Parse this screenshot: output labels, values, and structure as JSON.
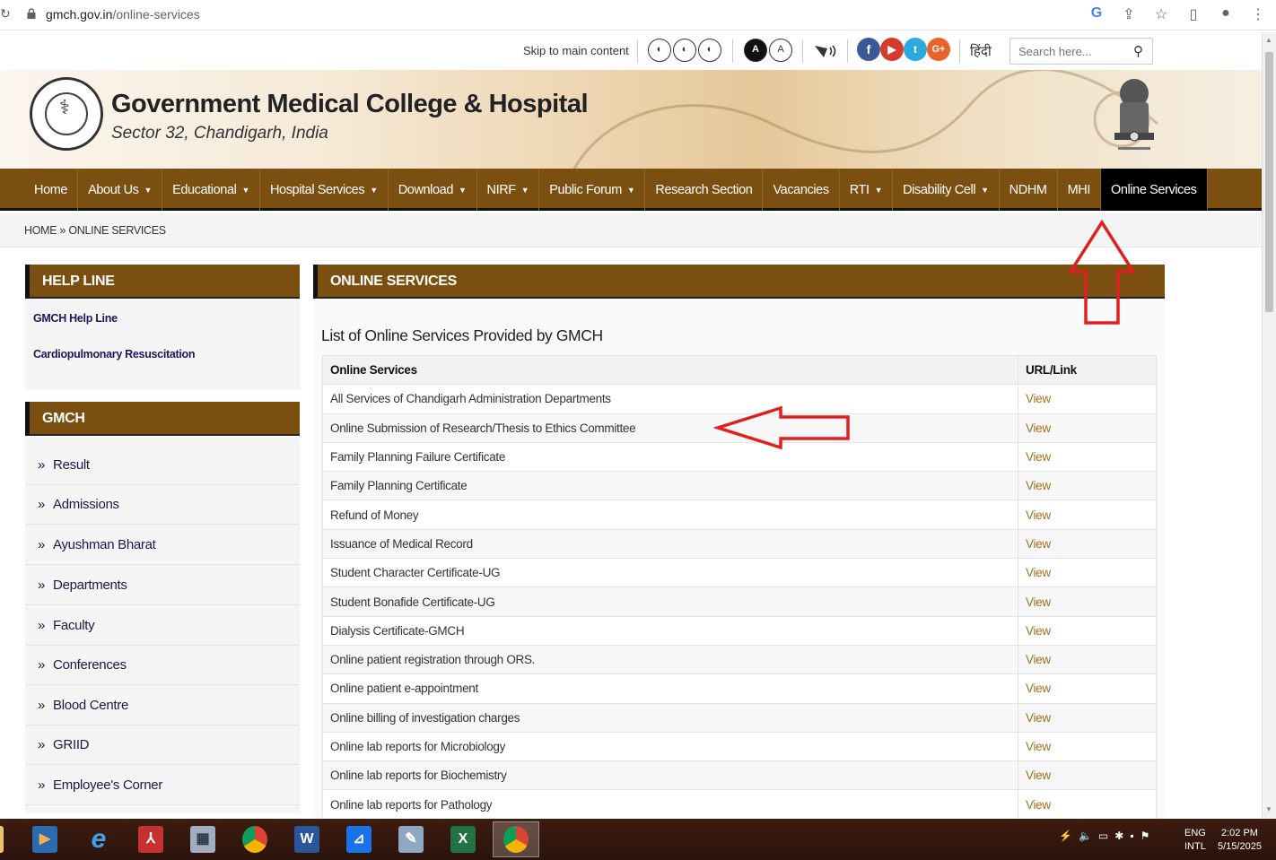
{
  "browser": {
    "url_host": "gmch.gov.in",
    "url_path": "/online-services"
  },
  "util": {
    "skip_label": "Skip to main content",
    "font_small": "A",
    "font_normal": "A",
    "hindi_label": "हिंदी",
    "search_placeholder": "Search here..."
  },
  "header": {
    "title": "Government Medical College & Hospital",
    "subtitle": "Sector 32, Chandigarh, India"
  },
  "nav": {
    "items": [
      {
        "label": "Home",
        "dropdown": false
      },
      {
        "label": "About Us",
        "dropdown": true
      },
      {
        "label": "Educational",
        "dropdown": true
      },
      {
        "label": "Hospital Services",
        "dropdown": true
      },
      {
        "label": "Download",
        "dropdown": true
      },
      {
        "label": "NIRF",
        "dropdown": true
      },
      {
        "label": "Public Forum",
        "dropdown": true
      },
      {
        "label": "Research Section",
        "dropdown": false
      },
      {
        "label": "Vacancies",
        "dropdown": false
      },
      {
        "label": "RTI",
        "dropdown": true
      },
      {
        "label": "Disability Cell",
        "dropdown": true
      },
      {
        "label": "NDHM",
        "dropdown": false
      },
      {
        "label": "MHI",
        "dropdown": false
      },
      {
        "label": "Online Services",
        "dropdown": false
      }
    ]
  },
  "breadcrumb": {
    "home": "HOME",
    "sep": "»",
    "current": "ONLINE SERVICES"
  },
  "sidebar": {
    "helpline_title": "HELP LINE",
    "helpline_links": [
      "GMCH Help Line",
      "Cardiopulmonary Resuscitation"
    ],
    "gmch_title": "GMCH",
    "gmch_items": [
      "Result",
      "Admissions",
      "Ayushman Bharat",
      "Departments",
      "Faculty",
      "Conferences",
      "Blood Centre",
      "GRIID",
      "Employee's Corner"
    ],
    "bullet": "»"
  },
  "main": {
    "section_title": "ONLINE SERVICES",
    "list_title": "List of Online Services Provided by GMCH",
    "table": {
      "headers": [
        "Online Services",
        "URL/Link"
      ],
      "rows": [
        {
          "service": "All Services of Chandigarh Administration Departments",
          "link": "View"
        },
        {
          "service": "Online Submission of Research/Thesis to Ethics Committee",
          "link": "View"
        },
        {
          "service": "Family Planning Failure Certificate",
          "link": "View"
        },
        {
          "service": "Family Planning Certificate",
          "link": "View"
        },
        {
          "service": "Refund of Money",
          "link": "View"
        },
        {
          "service": "Issuance of Medical Record",
          "link": "View"
        },
        {
          "service": "Student Character Certificate-UG",
          "link": "View"
        },
        {
          "service": "Student Bonafide Certificate-UG",
          "link": "View"
        },
        {
          "service": "Dialysis Certificate-GMCH",
          "link": "View"
        },
        {
          "service": "Online patient registration through ORS.",
          "link": "View"
        },
        {
          "service": "Online patient e-appointment",
          "link": "View"
        },
        {
          "service": "Online billing of investigation charges",
          "link": "View"
        },
        {
          "service": "Online lab reports for Microbiology",
          "link": "View"
        },
        {
          "service": "Online lab reports for Biochemistry",
          "link": "View"
        },
        {
          "service": "Online lab reports for Pathology",
          "link": "View"
        }
      ]
    }
  },
  "taskbar": {
    "lang_top": "ENG",
    "lang_bottom": "INTL",
    "time": "2:02 PM",
    "date": "5/15/2025"
  },
  "colors": {
    "nav_brown": "#7b4f10",
    "link_gold": "#a0701c",
    "annotation_red": "#e02020"
  }
}
